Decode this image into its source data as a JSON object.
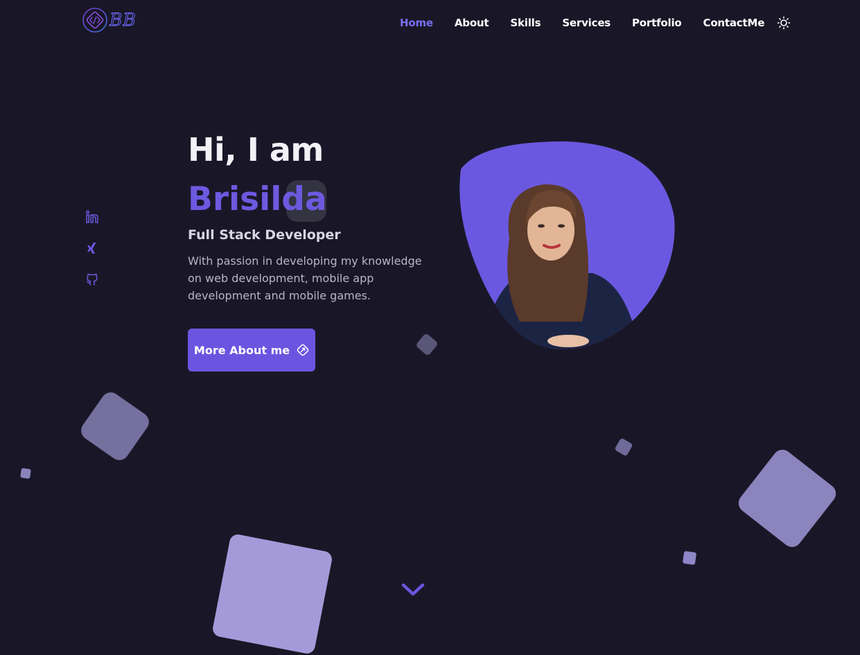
{
  "header": {
    "logo_text": "BB",
    "nav": [
      {
        "label": "Home",
        "active": true
      },
      {
        "label": "About",
        "active": false
      },
      {
        "label": "Skills",
        "active": false
      },
      {
        "label": "Services",
        "active": false
      },
      {
        "label": "Portfolio",
        "active": false
      },
      {
        "label": "ContactMe",
        "active": false
      }
    ],
    "theme_icon": "sun-icon"
  },
  "socials": [
    {
      "name": "linkedin-icon"
    },
    {
      "name": "xing-icon"
    },
    {
      "name": "github-icon"
    }
  ],
  "hero": {
    "greeting": "Hi, I am",
    "name": "Brisilda",
    "role": "Full Stack Developer",
    "bio": "With passion in developing my knowledge on web development, mobile app development and mobile games.",
    "cta_label": "More About me",
    "cta_icon": "send-icon",
    "scroll_icon": "chevron-down-icon"
  },
  "colors": {
    "background": "#191727",
    "accent": "#6b55e0",
    "nav_active": "#7a6ef0",
    "portrait_blob": "#6b58e0"
  }
}
